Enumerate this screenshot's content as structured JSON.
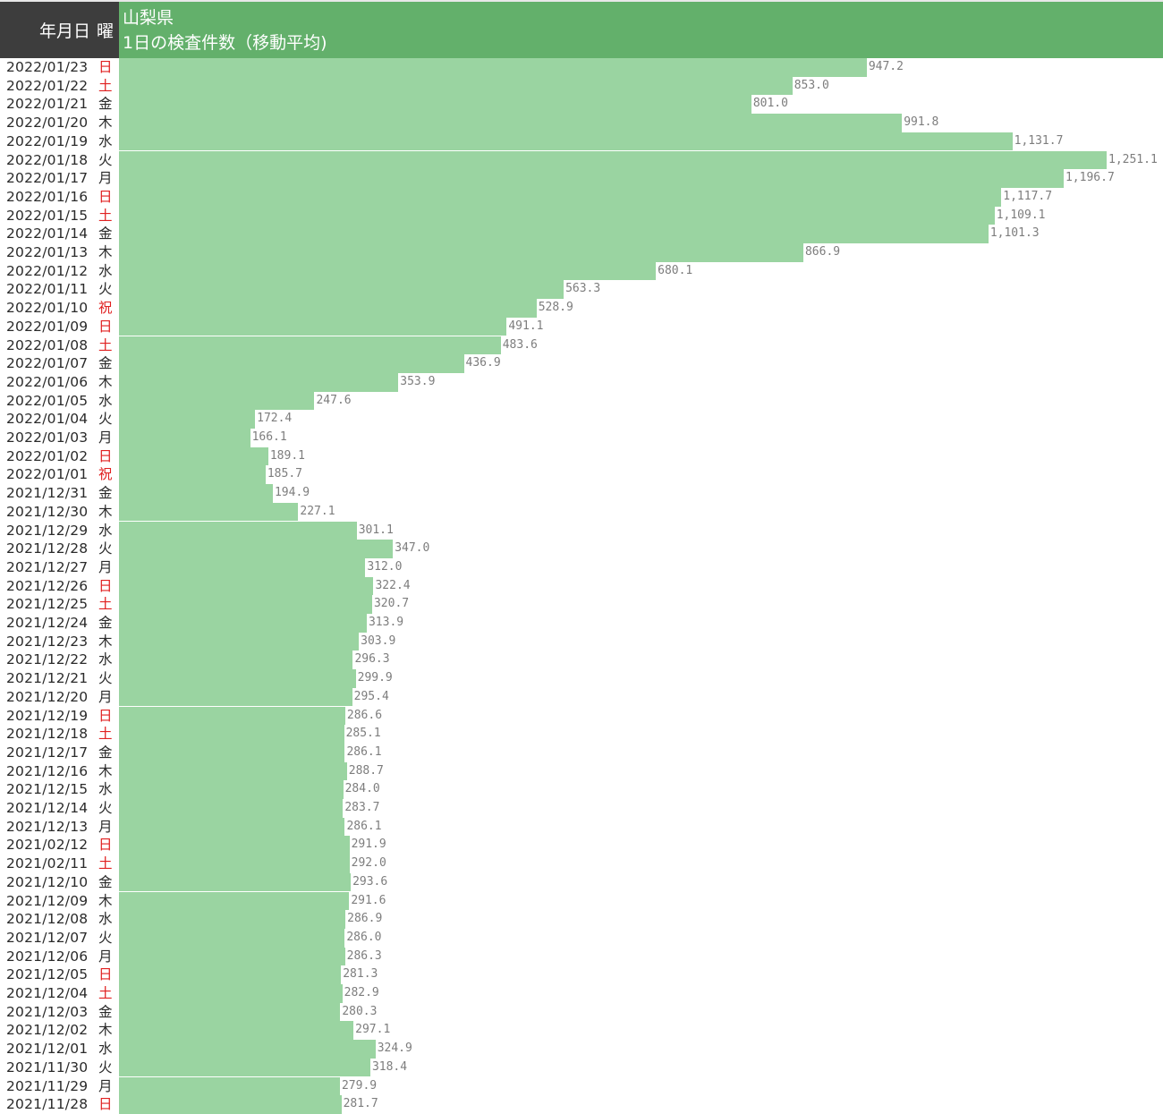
{
  "header": {
    "date_col": "年月日",
    "weekday_col": "曜",
    "title_line1": "山梨県",
    "title_line2": "1日の検査件数（移動平均)"
  },
  "colors": {
    "bar": "#9ad4a1",
    "header_green": "#63b06b",
    "header_dark": "#3d3d3d",
    "holiday_red": "#e02020"
  },
  "chart_data": {
    "type": "bar",
    "orientation": "horizontal",
    "title": "山梨県 1日の検査件数（移動平均)",
    "xlim": [
      0,
      1251.1
    ],
    "rows": [
      {
        "date": "2022/01/23",
        "weekday": "日",
        "red": true,
        "value": 947.2,
        "label": "947.2"
      },
      {
        "date": "2022/01/22",
        "weekday": "土",
        "red": true,
        "value": 853.0,
        "label": "853.0"
      },
      {
        "date": "2022/01/21",
        "weekday": "金",
        "red": false,
        "value": 801.0,
        "label": "801.0"
      },
      {
        "date": "2022/01/20",
        "weekday": "木",
        "red": false,
        "value": 991.8,
        "label": "991.8"
      },
      {
        "date": "2022/01/19",
        "weekday": "水",
        "red": false,
        "value": 1131.7,
        "label": "1,131.7"
      },
      {
        "date": "2022/01/18",
        "weekday": "火",
        "red": false,
        "value": 1251.1,
        "label": "1,251.1"
      },
      {
        "date": "2022/01/17",
        "weekday": "月",
        "red": false,
        "value": 1196.7,
        "label": "1,196.7"
      },
      {
        "date": "2022/01/16",
        "weekday": "日",
        "red": true,
        "value": 1117.7,
        "label": "1,117.7"
      },
      {
        "date": "2022/01/15",
        "weekday": "土",
        "red": true,
        "value": 1109.1,
        "label": "1,109.1"
      },
      {
        "date": "2022/01/14",
        "weekday": "金",
        "red": false,
        "value": 1101.3,
        "label": "1,101.3"
      },
      {
        "date": "2022/01/13",
        "weekday": "木",
        "red": false,
        "value": 866.9,
        "label": "866.9"
      },
      {
        "date": "2022/01/12",
        "weekday": "水",
        "red": false,
        "value": 680.1,
        "label": "680.1"
      },
      {
        "date": "2022/01/11",
        "weekday": "火",
        "red": false,
        "value": 563.3,
        "label": "563.3"
      },
      {
        "date": "2022/01/10",
        "weekday": "祝",
        "red": true,
        "value": 528.9,
        "label": "528.9"
      },
      {
        "date": "2022/01/09",
        "weekday": "日",
        "red": true,
        "value": 491.1,
        "label": "491.1"
      },
      {
        "date": "2022/01/08",
        "weekday": "土",
        "red": true,
        "value": 483.6,
        "label": "483.6"
      },
      {
        "date": "2022/01/07",
        "weekday": "金",
        "red": false,
        "value": 436.9,
        "label": "436.9"
      },
      {
        "date": "2022/01/06",
        "weekday": "木",
        "red": false,
        "value": 353.9,
        "label": "353.9"
      },
      {
        "date": "2022/01/05",
        "weekday": "水",
        "red": false,
        "value": 247.6,
        "label": "247.6"
      },
      {
        "date": "2022/01/04",
        "weekday": "火",
        "red": false,
        "value": 172.4,
        "label": "172.4"
      },
      {
        "date": "2022/01/03",
        "weekday": "月",
        "red": false,
        "value": 166.1,
        "label": "166.1"
      },
      {
        "date": "2022/01/02",
        "weekday": "日",
        "red": true,
        "value": 189.1,
        "label": "189.1"
      },
      {
        "date": "2022/01/01",
        "weekday": "祝",
        "red": true,
        "value": 185.7,
        "label": "185.7"
      },
      {
        "date": "2021/12/31",
        "weekday": "金",
        "red": false,
        "value": 194.9,
        "label": "194.9"
      },
      {
        "date": "2021/12/30",
        "weekday": "木",
        "red": false,
        "value": 227.1,
        "label": "227.1"
      },
      {
        "date": "2021/12/29",
        "weekday": "水",
        "red": false,
        "value": 301.1,
        "label": "301.1"
      },
      {
        "date": "2021/12/28",
        "weekday": "火",
        "red": false,
        "value": 347.0,
        "label": "347.0"
      },
      {
        "date": "2021/12/27",
        "weekday": "月",
        "red": false,
        "value": 312.0,
        "label": "312.0"
      },
      {
        "date": "2021/12/26",
        "weekday": "日",
        "red": true,
        "value": 322.4,
        "label": "322.4"
      },
      {
        "date": "2021/12/25",
        "weekday": "土",
        "red": true,
        "value": 320.7,
        "label": "320.7"
      },
      {
        "date": "2021/12/24",
        "weekday": "金",
        "red": false,
        "value": 313.9,
        "label": "313.9"
      },
      {
        "date": "2021/12/23",
        "weekday": "木",
        "red": false,
        "value": 303.9,
        "label": "303.9"
      },
      {
        "date": "2021/12/22",
        "weekday": "水",
        "red": false,
        "value": 296.3,
        "label": "296.3"
      },
      {
        "date": "2021/12/21",
        "weekday": "火",
        "red": false,
        "value": 299.9,
        "label": "299.9"
      },
      {
        "date": "2021/12/20",
        "weekday": "月",
        "red": false,
        "value": 295.4,
        "label": "295.4"
      },
      {
        "date": "2021/12/19",
        "weekday": "日",
        "red": true,
        "value": 286.6,
        "label": "286.6"
      },
      {
        "date": "2021/12/18",
        "weekday": "土",
        "red": true,
        "value": 285.1,
        "label": "285.1"
      },
      {
        "date": "2021/12/17",
        "weekday": "金",
        "red": false,
        "value": 286.1,
        "label": "286.1"
      },
      {
        "date": "2021/12/16",
        "weekday": "木",
        "red": false,
        "value": 288.7,
        "label": "288.7"
      },
      {
        "date": "2021/12/15",
        "weekday": "水",
        "red": false,
        "value": 284.0,
        "label": "284.0"
      },
      {
        "date": "2021/12/14",
        "weekday": "火",
        "red": false,
        "value": 283.7,
        "label": "283.7"
      },
      {
        "date": "2021/12/13",
        "weekday": "月",
        "red": false,
        "value": 286.1,
        "label": "286.1"
      },
      {
        "date": "2021/02/12",
        "weekday": "日",
        "red": true,
        "value": 291.9,
        "label": "291.9"
      },
      {
        "date": "2021/02/11",
        "weekday": "土",
        "red": true,
        "value": 292.0,
        "label": "292.0"
      },
      {
        "date": "2021/12/10",
        "weekday": "金",
        "red": false,
        "value": 293.6,
        "label": "293.6"
      },
      {
        "date": "2021/12/09",
        "weekday": "木",
        "red": false,
        "value": 291.6,
        "label": "291.6"
      },
      {
        "date": "2021/12/08",
        "weekday": "水",
        "red": false,
        "value": 286.9,
        "label": "286.9"
      },
      {
        "date": "2021/12/07",
        "weekday": "火",
        "red": false,
        "value": 286.0,
        "label": "286.0"
      },
      {
        "date": "2021/12/06",
        "weekday": "月",
        "red": false,
        "value": 286.3,
        "label": "286.3"
      },
      {
        "date": "2021/12/05",
        "weekday": "日",
        "red": true,
        "value": 281.3,
        "label": "281.3"
      },
      {
        "date": "2021/12/04",
        "weekday": "土",
        "red": true,
        "value": 282.9,
        "label": "282.9"
      },
      {
        "date": "2021/12/03",
        "weekday": "金",
        "red": false,
        "value": 280.3,
        "label": "280.3"
      },
      {
        "date": "2021/12/02",
        "weekday": "木",
        "red": false,
        "value": 297.1,
        "label": "297.1"
      },
      {
        "date": "2021/12/01",
        "weekday": "水",
        "red": false,
        "value": 324.9,
        "label": "324.9"
      },
      {
        "date": "2021/11/30",
        "weekday": "火",
        "red": false,
        "value": 318.4,
        "label": "318.4"
      },
      {
        "date": "2021/11/29",
        "weekday": "月",
        "red": false,
        "value": 279.9,
        "label": "279.9"
      },
      {
        "date": "2021/11/28",
        "weekday": "日",
        "red": true,
        "value": 281.7,
        "label": "281.7"
      }
    ]
  }
}
